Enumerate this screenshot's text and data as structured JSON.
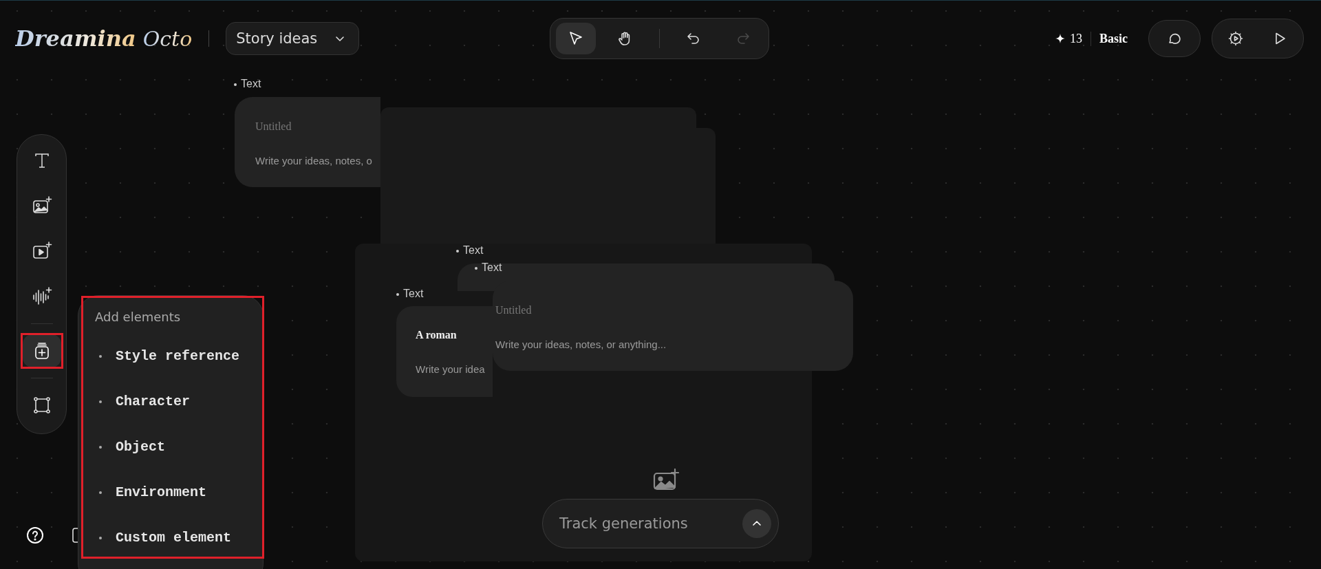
{
  "header": {
    "logo": {
      "word": "Dreamina",
      "mark": "Octo"
    },
    "project_menu": {
      "label": "Story ideas"
    }
  },
  "toolbar": {
    "tools": [
      {
        "kind": "select",
        "selected": true
      },
      {
        "kind": "hand",
        "selected": false
      }
    ],
    "history": [
      {
        "kind": "undo",
        "disabled": false
      },
      {
        "kind": "redo",
        "disabled": true
      }
    ]
  },
  "account": {
    "credits": "13",
    "plan": "Basic"
  },
  "side_tools": [
    {
      "kind": "text",
      "selected": false
    },
    {
      "kind": "image",
      "selected": false
    },
    {
      "kind": "video",
      "selected": false
    },
    {
      "kind": "audio",
      "selected": false
    },
    {
      "kind": "elements",
      "selected": true
    },
    {
      "kind": "frame",
      "selected": false
    }
  ],
  "add_menu": {
    "title": "Add elements",
    "items": [
      "Style reference",
      "Character",
      "Object",
      "Environment",
      "Custom element"
    ]
  },
  "canvas": {
    "nodes": [
      {
        "label": "Text",
        "title": "Untitled",
        "title_placeholder": true,
        "body": "Write your ideas, notes, o"
      },
      {
        "label": "Text"
      },
      {
        "label": "Text",
        "title": "Untitled",
        "title_placeholder": true,
        "body": "Write your ideas, notes, or anything..."
      },
      {
        "label": "Text",
        "title": "A roman",
        "title_placeholder": false,
        "body": "Write your idea"
      }
    ]
  },
  "track": {
    "label": "Track generations"
  }
}
